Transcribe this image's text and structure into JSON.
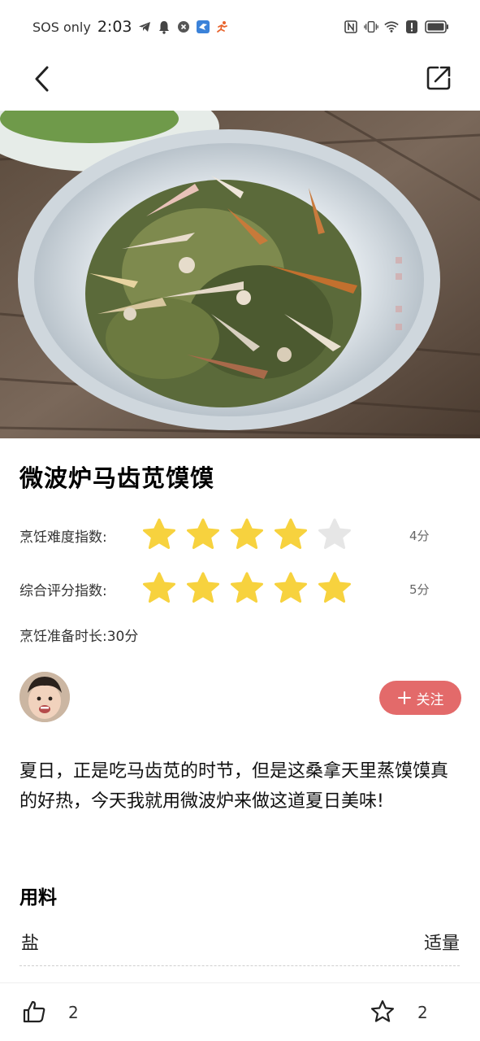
{
  "status_bar": {
    "carrier": "SOS only",
    "time": "2:03",
    "left_icons": [
      "telegram-icon",
      "bell-icon",
      "shield-x-icon",
      "bird-app-icon",
      "running-app-icon"
    ],
    "right_icons": [
      "nfc-icon",
      "vibrate-icon",
      "wifi-icon",
      "alert-icon",
      "battery-icon"
    ]
  },
  "nav": {
    "back_icon": "chevron-left-icon",
    "share_icon": "share-external-icon"
  },
  "recipe": {
    "title": "微波炉马齿苋馍馍",
    "difficulty": {
      "label": "烹饪难度指数:",
      "stars_filled": 4,
      "stars_total": 5,
      "score": "4分"
    },
    "overall": {
      "label": "综合评分指数:",
      "stars_filled": 5,
      "stars_total": 5,
      "score": "5分"
    },
    "prep_time": "烹饪准备时长:30分",
    "description": "夏日，正是吃马齿苋的时节，但是这桑拿天里蒸馍馍真的好热，今天我就用微波炉来做这道夏日美味!"
  },
  "author": {
    "follow_label": "关注"
  },
  "ingredients": {
    "title": "用料",
    "items": [
      {
        "name": "盐",
        "amount": "适量"
      }
    ]
  },
  "bottom_bar": {
    "like_count": "2",
    "favorite_count": "2"
  },
  "colors": {
    "star_filled": "#f7d23e",
    "star_empty": "#e6e6e6",
    "follow_button": "#e36a6a"
  }
}
